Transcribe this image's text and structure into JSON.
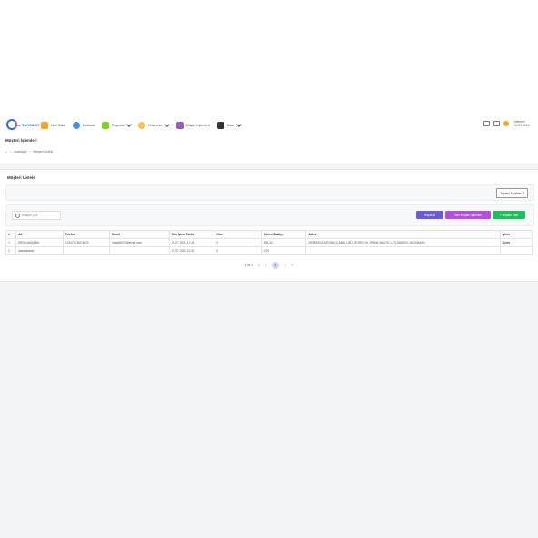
{
  "app": {
    "logo_text": "Sac TAHSILAT"
  },
  "nav": [
    {
      "label": "Hizli Satis",
      "icon": "cart-icon",
      "color": "#f5a623",
      "has_menu": false
    },
    {
      "label": "Kullanici",
      "icon": "users-icon",
      "color": "#4a90e2",
      "has_menu": false
    },
    {
      "label": "Raporlar",
      "icon": "reports-icon",
      "color": "#7ed321",
      "has_menu": true
    },
    {
      "label": "Odemeler",
      "icon": "payments-icon",
      "color": "#f8c24a",
      "has_menu": true
    },
    {
      "label": "Müşteri İşlemleri",
      "icon": "customers-icon",
      "color": "#9b59b6",
      "has_menu": false
    },
    {
      "label": "Kasa",
      "icon": "cashbox-icon",
      "color": "#333333",
      "has_menu": true
    }
  ],
  "header_user": {
    "name": "Mehmet",
    "date": "04.07.2021"
  },
  "page": {
    "title": "Müşteri İşlemleri",
    "breadcrumb": [
      "Anasayfa",
      "Müşteri Listesi"
    ]
  },
  "card": {
    "title": "Müşteri Listele",
    "filter_button": "Toplam Müşteri: 2",
    "search_placeholder": "Müşteri Ara",
    "buttons": {
      "rapor": "Rapor al",
      "yeni_islem": "Yeni Müşteri İşlemleri",
      "musteri_ekle": "+ Müşteri Ekle"
    }
  },
  "table": {
    "headers": [
      "#",
      "Ad",
      "Telefon",
      "Email",
      "Son İşlem Tarihi",
      "Gün",
      "Güncel Bakiye",
      "Adres",
      "İşlem"
    ],
    "rows": [
      [
        "1",
        "İRFAN AKBABA",
        "0 (5471) 960 6623",
        "irfan66570@gmail.com",
        "04.07.2021 17:49",
        "0",
        "396,43",
        "SEBEKECİLER MAH.ÇAMLI CAD.ÇEVREYOL İRFAN SAN.TİC.LTD MADEN / ADIYAMAN",
        "Detay"
      ],
      [
        "2",
        "yasadsdsds",
        "",
        "",
        "07.07.2021 21:32",
        "0",
        "0,00",
        "",
        ""
      ]
    ]
  },
  "pager": {
    "info": "1 of 1",
    "first": "«",
    "prev": "‹",
    "current": "1",
    "next": "›",
    "last": "»"
  }
}
